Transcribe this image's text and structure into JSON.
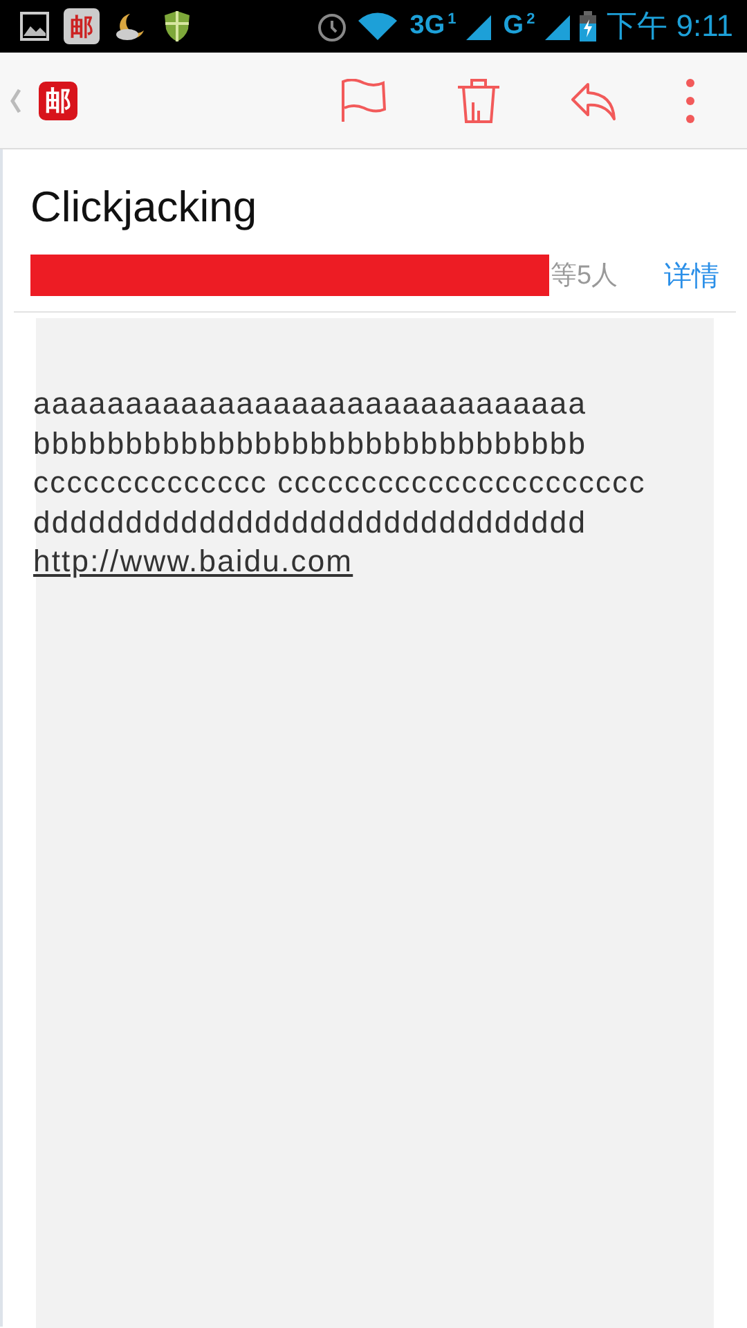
{
  "status_bar": {
    "app_badge": "邮",
    "network_1": "3G",
    "sim_1": "1",
    "network_2": "G",
    "sim_2": "2",
    "time": "下午 9:11"
  },
  "toolbar": {
    "app_logo": "邮"
  },
  "message": {
    "subject": "Clickjacking",
    "recipients_redacted": true,
    "recipients_more": "等5人",
    "details_link": "详情",
    "body_lines": [
      {
        "kind": "text",
        "text": "aaaaaaaaaaaaaaaaaaaaaaaaaaaaaa"
      },
      {
        "kind": "text",
        "text": "bbbbbbbbbbbbbbbbbbbbbbbbbbbbbb"
      },
      {
        "kind": "text",
        "text": "cccccccccccccc cccccccccccccccccccccc"
      },
      {
        "kind": "text",
        "text": "dddddddddddddddddddddddddddddd"
      },
      {
        "kind": "link",
        "text": "http://www.baidu.com"
      }
    ]
  }
}
